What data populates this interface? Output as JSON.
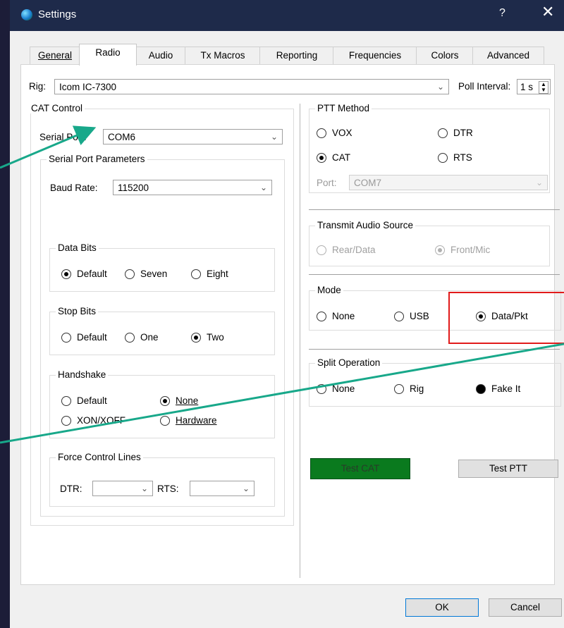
{
  "window": {
    "title": "Settings",
    "help": "?",
    "close": "✕"
  },
  "tabs": [
    {
      "label": "General"
    },
    {
      "label": "Radio"
    },
    {
      "label": "Audio"
    },
    {
      "label": "Tx Macros"
    },
    {
      "label": "Reporting"
    },
    {
      "label": "Frequencies"
    },
    {
      "label": "Colors"
    },
    {
      "label": "Advanced"
    }
  ],
  "active_tab": "Radio",
  "rig": {
    "label": "Rig:",
    "value": "Icom IC-7300",
    "poll_label": "Poll Interval:",
    "poll_value": "1 s"
  },
  "cat": {
    "title": "CAT Control",
    "serial_port_label": "Serial Port:",
    "serial_port_value": "COM6",
    "params_title": "Serial Port Parameters",
    "baud_label": "Baud Rate:",
    "baud_value": "115200",
    "data_bits": {
      "title": "Data Bits",
      "options": [
        "Default",
        "Seven",
        "Eight"
      ],
      "selected": "Default"
    },
    "stop_bits": {
      "title": "Stop Bits",
      "options": [
        "Default",
        "One",
        "Two"
      ],
      "selected": "Two"
    },
    "handshake": {
      "title": "Handshake",
      "options": [
        "Default",
        "None",
        "XON/XOFF",
        "Hardware"
      ],
      "selected": "None"
    },
    "force": {
      "title": "Force Control Lines",
      "dtr_label": "DTR:",
      "rts_label": "RTS:"
    }
  },
  "ptt": {
    "title": "PTT Method",
    "options": [
      "VOX",
      "DTR",
      "CAT",
      "RTS"
    ],
    "selected": "CAT",
    "port_label": "Port:",
    "port_value": "COM7"
  },
  "audio_source": {
    "title": "Transmit Audio Source",
    "options": [
      "Rear/Data",
      "Front/Mic"
    ],
    "selected": "Front/Mic"
  },
  "mode": {
    "title": "Mode",
    "options": [
      "None",
      "USB",
      "Data/Pkt"
    ],
    "selected": "Data/Pkt"
  },
  "split": {
    "title": "Split Operation",
    "options": [
      "None",
      "Rig",
      "Fake It"
    ],
    "selected": "Fake It"
  },
  "buttons": {
    "test_cat": "Test CAT",
    "test_ptt": "Test PTT",
    "ok": "OK",
    "cancel": "Cancel"
  },
  "colors": {
    "highlight_box": "#e11b1b",
    "arrow": "#18a88a",
    "test_cat_bg": "#0a7a1e",
    "title_bar": "#1e2a4a"
  }
}
